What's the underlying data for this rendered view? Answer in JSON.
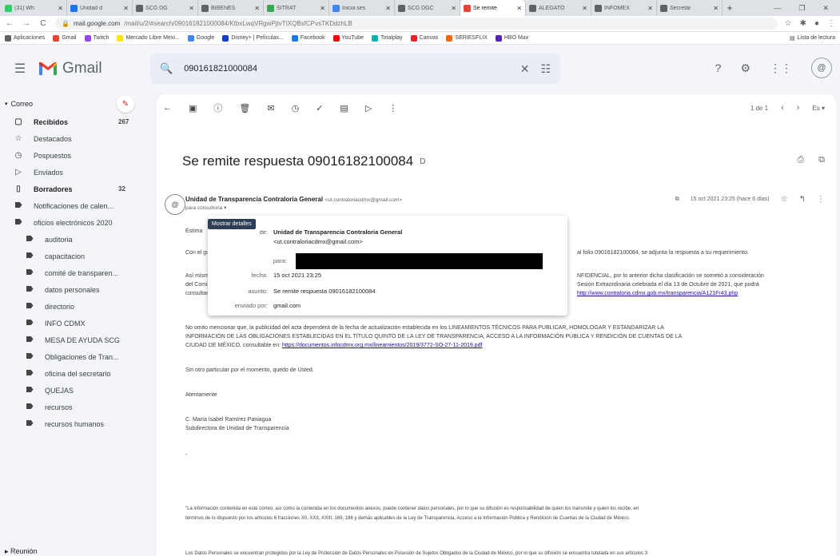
{
  "browser": {
    "tabs": [
      {
        "label": "(31) Wh",
        "color": "#25d366",
        "active": false
      },
      {
        "label": "Unidad d",
        "color": "#1a73e8",
        "active": false
      },
      {
        "label": "SCG DG",
        "color": "#5f6368",
        "active": false
      },
      {
        "label": "BIBENES",
        "color": "#5f6368",
        "active": false
      },
      {
        "label": "SITRAT",
        "color": "#34a853",
        "active": false
      },
      {
        "label": "Inicia ses",
        "color": "#4285f4",
        "active": false
      },
      {
        "label": "SCG DGC",
        "color": "#5f6368",
        "active": false
      },
      {
        "label": "Se remite",
        "color": "#ea4335",
        "active": true
      },
      {
        "label": "ALEGATO",
        "color": "#5f6368",
        "active": false
      },
      {
        "label": "INFOMEX",
        "color": "#5f6368",
        "active": false
      },
      {
        "label": "Secretar",
        "color": "#5f6368",
        "active": false
      }
    ],
    "url_domain": "mail.google.com",
    "url_path": "/mail/u/2/#search/090161821000084/KtbxLwqVRgwPjtvTtXQBsfCPvsTKDdzhLB",
    "bookmarks": [
      {
        "label": "Aplicaciones",
        "color": "#5f6368"
      },
      {
        "label": "Gmail",
        "color": "#ea4335"
      },
      {
        "label": "Twitch",
        "color": "#9146ff"
      },
      {
        "label": "Mercado Libre Mexi...",
        "color": "#ffe600"
      },
      {
        "label": "Google",
        "color": "#4285f4"
      },
      {
        "label": "Disney+ | Películas...",
        "color": "#113ccf"
      },
      {
        "label": "Facebook",
        "color": "#1877f2"
      },
      {
        "label": "YouTube",
        "color": "#ff0000"
      },
      {
        "label": "Totalplay",
        "color": "#00b2a9"
      },
      {
        "label": "Canvas",
        "color": "#e72429"
      },
      {
        "label": "SERIESFLIX",
        "color": "#ff6600"
      },
      {
        "label": "HBO Max",
        "color": "#5822b4"
      }
    ],
    "reading_list": "Lista de lectura"
  },
  "gmail": {
    "app_name": "Gmail",
    "search_value": "090161821000084"
  },
  "sidebar": {
    "section_label": "Correo",
    "items": [
      {
        "label": "Recibidos",
        "icon": "inbox-icon",
        "count": "267",
        "bold": true,
        "sub": false
      },
      {
        "label": "Destacados",
        "icon": "star-icon",
        "count": "",
        "bold": false,
        "sub": false
      },
      {
        "label": "Pospuestos",
        "icon": "clock-icon",
        "count": "",
        "bold": false,
        "sub": false
      },
      {
        "label": "Enviados",
        "icon": "send-icon",
        "count": "",
        "bold": false,
        "sub": false
      },
      {
        "label": "Borradores",
        "icon": "draft-icon",
        "count": "32",
        "bold": true,
        "sub": false
      },
      {
        "label": "Notificaciones de calen...",
        "icon": "label-icon",
        "count": "",
        "bold": false,
        "sub": false
      },
      {
        "label": "oficios electrónicos 2020",
        "icon": "label-icon",
        "count": "",
        "bold": false,
        "sub": false
      },
      {
        "label": "auditoria",
        "icon": "label-icon",
        "count": "",
        "bold": false,
        "sub": true
      },
      {
        "label": "capacitacion",
        "icon": "label-icon",
        "count": "",
        "bold": false,
        "sub": true
      },
      {
        "label": "comité de transparen...",
        "icon": "label-icon",
        "count": "",
        "bold": false,
        "sub": true
      },
      {
        "label": "datos personales",
        "icon": "label-icon",
        "count": "",
        "bold": false,
        "sub": true
      },
      {
        "label": "directorio",
        "icon": "label-icon",
        "count": "",
        "bold": false,
        "sub": true
      },
      {
        "label": "INFO CDMX",
        "icon": "label-icon",
        "count": "",
        "bold": false,
        "sub": true
      },
      {
        "label": "MESA DE AYUDA SCG",
        "icon": "label-icon",
        "count": "",
        "bold": false,
        "sub": true
      },
      {
        "label": "Obligaciones de Tran...",
        "icon": "label-icon",
        "count": "",
        "bold": false,
        "sub": true
      },
      {
        "label": "oficina del secretario",
        "icon": "label-icon",
        "count": "",
        "bold": false,
        "sub": true
      },
      {
        "label": "QUEJAS",
        "icon": "label-icon",
        "count": "",
        "bold": false,
        "sub": true
      },
      {
        "label": "recursos",
        "icon": "label-icon",
        "count": "",
        "bold": false,
        "sub": true
      },
      {
        "label": "recursos humanos",
        "icon": "label-icon",
        "count": "",
        "bold": false,
        "sub": true
      }
    ],
    "footer_label": "Reunión"
  },
  "mail": {
    "pager": "1 de 1",
    "lang": "Es",
    "subject": "Se remite respuesta 09016182100084",
    "subject_tag": "D",
    "sender_name": "Unidad de Transparencia Contraloria General",
    "sender_email": "<ut.contraloriacdmx@gmail.com>",
    "recipient": "para consultoria",
    "date_label": "15 oct 2021 23:25 (hace 6 días)",
    "tooltip": "Mostrar detalles",
    "details": {
      "de_key": "de:",
      "de_name": "Unidad de Transparencia Contraloria General",
      "de_email": "<ut.contraloriacdmx@gmail.com>",
      "para_key": "para:",
      "fecha_key": "fecha:",
      "fecha_val": "15 oct 2021 23:25",
      "asunto_key": "asunto:",
      "asunto_val": "Se remite respuesta 09016182100084",
      "enviado_key": "enviado por:",
      "enviado_val": "gmail.com"
    },
    "body": {
      "greeting": "Estima",
      "p1_start": "Con el gusto de",
      "p1_end": "al folio 09016182100084, se adjunta la respuesta a su requerimiento.",
      "p2_start_a": "Así mismo, se h",
      "p2_start_b": "del Comité de Tr",
      "p2_start_c": "consultarse en la",
      "p2_end_a": "NFIDENCIAL, por lo anterior dicha clasificación se sometió a consideración",
      "p2_end_b": "Sesión Extraordinaria celebrada el día 13 de Octubre de 2021, que podrá",
      "p2_link": "http://www.contraloria.cdmx.gob.mx/transparencia/A121Fr43.php",
      "p3_a": "No omito mencionar que, la publicidad del acta dependerá de la fecha de actualización establecida en los LINEAMIENTOS TÉCNICOS PARA PUBLICAR, HOMOLOGAR Y ESTANDARIZAR LA",
      "p3_b": "INFORMACIÓN DE LAS OBLIGACIONES ESTABLECIDAS EN EL TÍTULO QUINTO DE LA LEY DE TRANSPARENCIA, ACCESO A LA INFORMACIÓN PÚBLICA Y RENDICIÓN DE CUENTAS DE LA",
      "p3_c": "CIUDAD DE MÉXICO, consultable en:",
      "p3_link": "https://documentos.infocdmx.org.mx/lineamientos/2019/3772-SO-27-11-2019.pdf",
      "p4": "Sin otro particular por el momento, quedo de Usted.",
      "p5": "Atentamente",
      "sig_name": "C. María Isabel Ramírez Paniagua",
      "sig_title": "Subdirectora de Unidad de Transparencia",
      "dash": "-",
      "legal_a": "\"La información contenida en este correo, así como la contenida en los documentos anexos, puede contener datos personales, por lo que su difusión es responsabilidad de quien los transmite y quien los recibe, en",
      "legal_b": "términos de lo dispuesto por los artículos 6 fracciones XII, XXII, XXIII; 169, 186 y demás aplicables de la Ley de Transparencia, Acceso a la Información Pública y Rendición de Cuentas de la Ciudad de México.",
      "legal_c": "Los Datos Personales se encuentran protegidos por la Ley de Protección de Datos Personales en Posesión de Sujetos Obligados de la Ciudad de México, por lo que su difusión se encuentra tutelada en sus artículos 3"
    }
  }
}
